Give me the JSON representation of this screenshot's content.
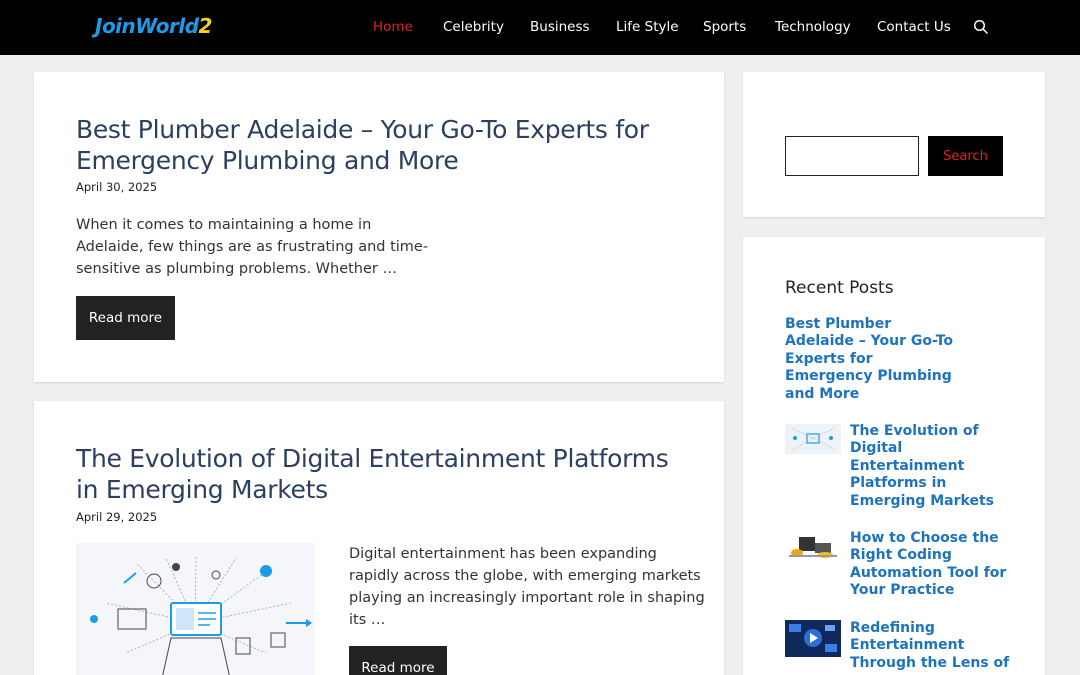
{
  "header": {
    "logo_part1": "JoinWorld",
    "logo_part2": "2",
    "nav": [
      {
        "label": "Home",
        "active": true
      },
      {
        "label": "Celebrity"
      },
      {
        "label": "Business"
      },
      {
        "label": "Life Style"
      },
      {
        "label": "Sports"
      },
      {
        "label": "Technology"
      },
      {
        "label": "Contact Us"
      }
    ],
    "search_icon": "search-icon"
  },
  "posts": [
    {
      "title_line1": "Best Plumber Adelaide – Your Go-To Experts for",
      "title_line2": "Emergency Plumbing and More",
      "date": "April 30, 2025",
      "excerpt_line1": "When it comes to maintaining a home in",
      "excerpt_line2": "Adelaide, few things are as frustrating and time-",
      "excerpt_line3": "sensitive as plumbing problems. Whether …",
      "read_more": "Read more"
    },
    {
      "title_line1": "The Evolution of Digital Entertainment Platforms",
      "title_line2": "in Emerging Markets",
      "date": "April 29, 2025",
      "excerpt_line1": "Digital entertainment has been expanding",
      "excerpt_line2": "rapidly across the globe, with emerging markets",
      "excerpt_line3": "playing an increasingly important role in shaping",
      "excerpt_line4": "its …",
      "read_more": "Read more"
    }
  ],
  "sidebar": {
    "search_value": "",
    "search_button": "Search",
    "recent_posts_title": "Recent Posts",
    "recent_posts": [
      {
        "lines": [
          "Best Plumber",
          "Adelaide – Your Go-To",
          "Experts for",
          "Emergency Plumbing",
          "and More"
        ]
      },
      {
        "lines": [
          "The Evolution of",
          "Digital",
          "Entertainment",
          "Platforms in",
          "Emerging Markets"
        ]
      },
      {
        "lines": [
          "How to Choose the",
          "Right Coding",
          "Automation Tool for",
          "Your Practice"
        ]
      },
      {
        "lines": [
          "Redefining",
          "Entertainment",
          "Through the Lens of"
        ]
      }
    ]
  },
  "colors": {
    "header_bg": "#000000",
    "active_nav": "#e02020",
    "title": "#2b3f5f",
    "link": "#1e73be"
  }
}
